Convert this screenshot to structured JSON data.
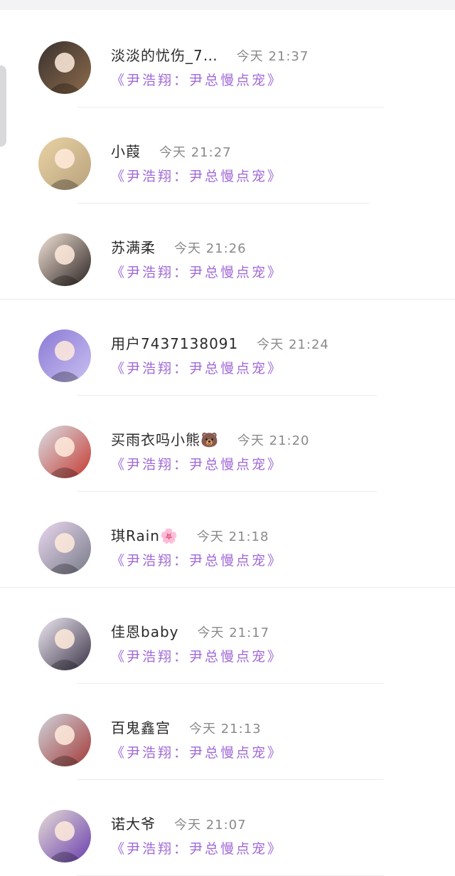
{
  "entries": [
    {
      "name": "淡淡的忧伤_7…",
      "time": "今天 21:37",
      "work": "《尹浩翔：尹总慢点宠》",
      "avatar": "avatar-harry-potter-character",
      "bg1": "#3a3230",
      "bg2": "#8c6a4a"
    },
    {
      "name": "小葭",
      "time": "今天 21:27",
      "work": "《尹浩翔：尹总慢点宠》",
      "avatar": "avatar-flower-crown-girl",
      "bg1": "#e9d3a4",
      "bg2": "#b9a27e"
    },
    {
      "name": "苏满柔",
      "time": "今天 21:26",
      "work": "《尹浩翔：尹总慢点宠》",
      "avatar": "avatar-young-man",
      "bg1": "#f3e4d8",
      "bg2": "#2b2220"
    },
    {
      "name": "用户7437138091",
      "time": "今天 21:24",
      "work": "《尹浩翔：尹总慢点宠》",
      "avatar": "avatar-stage-group",
      "bg1": "#8c7ad6",
      "bg2": "#c9bff0"
    },
    {
      "name": "买雨衣吗小熊🐻",
      "time": "今天 21:20",
      "work": "《尹浩翔：尹总慢点宠》",
      "avatar": "avatar-plumber-costume",
      "bg1": "#d8e0e6",
      "bg2": "#c63a32"
    },
    {
      "name": "琪Rain🌸",
      "time": "今天 21:18",
      "work": "《尹浩翔：尹总慢点宠》",
      "avatar": "avatar-cartoon-cat",
      "bg1": "#ead7ef",
      "bg2": "#777b88"
    },
    {
      "name": "佳恩baby",
      "time": "今天 21:17",
      "work": "《尹浩翔：尹总慢点宠》",
      "avatar": "avatar-toddler",
      "bg1": "#efe9f3",
      "bg2": "#3b3448"
    },
    {
      "name": "百鬼鑫宫",
      "time": "今天 21:13",
      "work": "《尹浩翔：尹总慢点宠》",
      "avatar": "avatar-red-hair-girl",
      "bg1": "#cfd5dc",
      "bg2": "#a43a38"
    },
    {
      "name": "诺大爷",
      "time": "今天 21:07",
      "work": "《尹浩翔：尹总慢点宠》",
      "avatar": "avatar-sleeping-boy",
      "bg1": "#e6dcd6",
      "bg2": "#6a3fae"
    }
  ]
}
